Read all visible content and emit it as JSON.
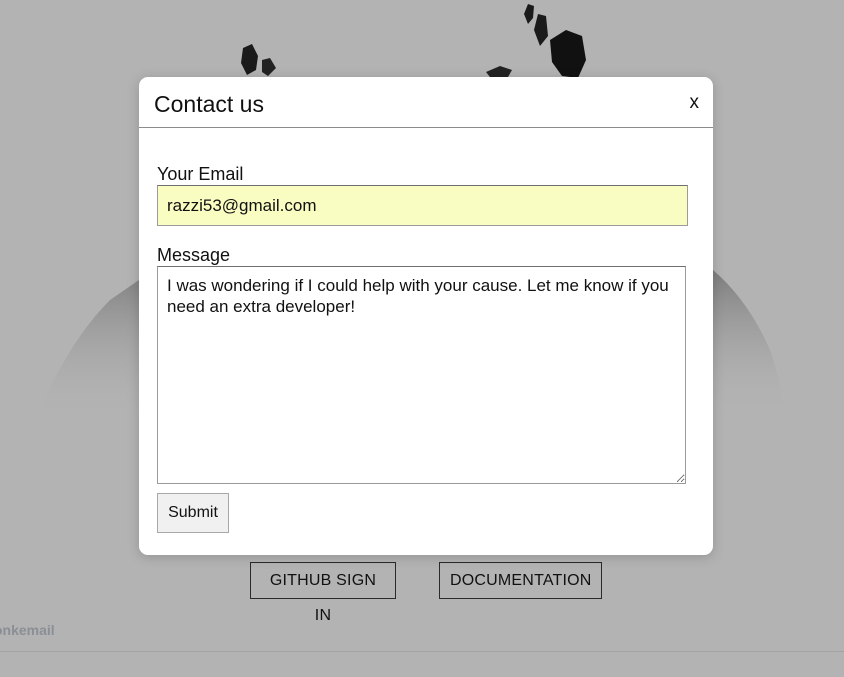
{
  "modal": {
    "title": "Contact us",
    "close_label": "x",
    "email": {
      "label": "Your Email",
      "value": "razzi53@gmail.com"
    },
    "message": {
      "label": "Message",
      "value": "I was wondering if I could help with your cause. Let me know if you need an extra developer!"
    },
    "submit_label": "Submit"
  },
  "background": {
    "github_button_label": "GITHUB SIGN IN",
    "docs_button_label": "DOCUMENTATION",
    "footer_brand": "onkemail"
  },
  "colors": {
    "overlay": "#b3b3b3",
    "email_fill": "#fafdc2",
    "modal_bg": "#ffffff"
  }
}
